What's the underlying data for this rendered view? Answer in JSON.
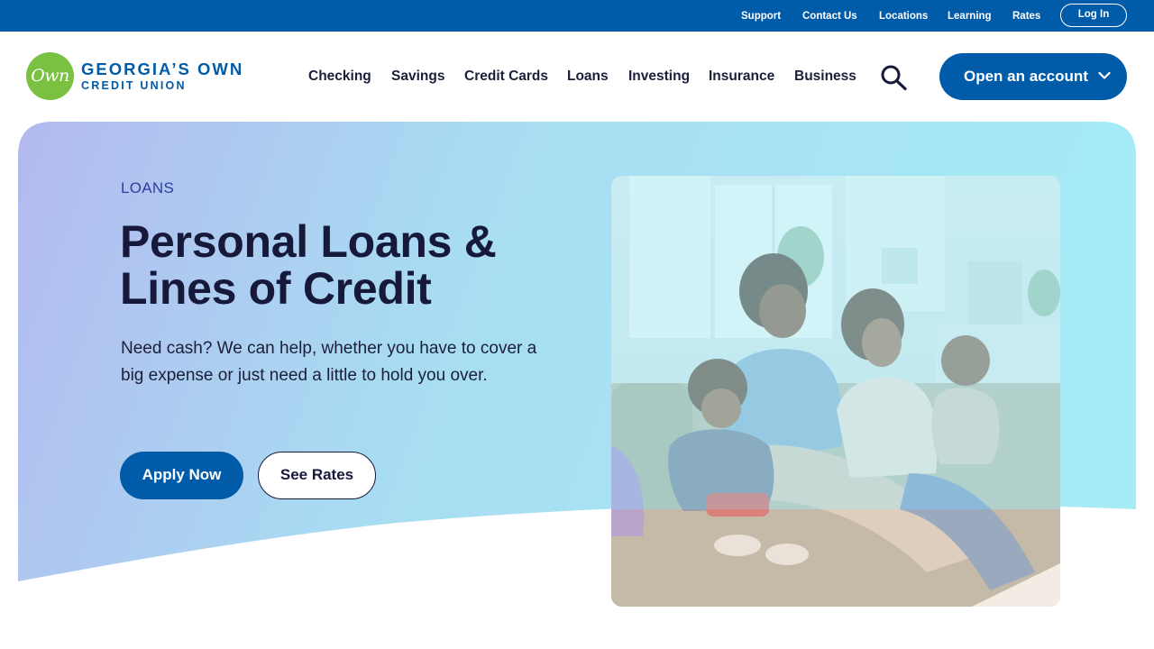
{
  "utility_nav": {
    "links": [
      "Support",
      "Contact Us",
      "Locations",
      "Learning",
      "Rates"
    ],
    "login_label": "Log In"
  },
  "brand": {
    "badge_text": "Own",
    "name": "GEORGIA’S OWN",
    "subtitle": "CREDIT UNION"
  },
  "main_nav": {
    "items": [
      "Checking",
      "Savings",
      "Credit Cards",
      "Loans",
      "Investing",
      "Insurance",
      "Business"
    ],
    "search_icon": "search-icon",
    "open_account_label": "Open an account",
    "open_account_icon": "chevron-down-icon"
  },
  "hero": {
    "eyebrow": "LOANS",
    "headline": "Personal Loans & Lines of Credit",
    "intro": "Need cash? We can help, whether you have to cover a big expense or just need a little to hold you over.",
    "primary_cta": "Apply Now",
    "secondary_cta": "See Rates"
  },
  "colors": {
    "brand_blue": "#005ba8",
    "brand_green": "#7ac142",
    "heading_navy": "#16193a",
    "eyebrow_blue": "#2f3d9e",
    "hero_gradient_start": "#b3b9ef",
    "hero_gradient_end": "#a8e8f4"
  }
}
